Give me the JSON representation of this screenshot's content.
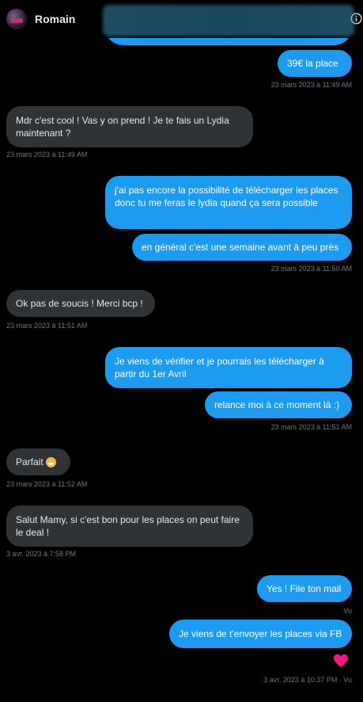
{
  "header": {
    "contact_name": "Romain"
  },
  "messages": [
    {
      "text": "39€ la place",
      "ts": "23 mars 2023 à 11:49 AM"
    },
    {
      "text": "Mdr c'est cool ! Vas y on prend ! Je te fais un Lydia maintenant ?",
      "ts": "23 mars 2023 à 11:49 AM"
    },
    {
      "text": "j'ai pas encore la possibilité de télécharger les places donc tu me feras le lydia quand ça sera possible"
    },
    {
      "text": "en général c'est une semaine avant à peu près",
      "ts": "23 mars 2023 à 11:50 AM"
    },
    {
      "text": "Ok pas de soucis ! Merci bcp !",
      "ts": "23 mars 2023 à 11:51 AM"
    },
    {
      "text": "Je viens de vérifier et je pourrais les télécharger à partir du 1er Avril"
    },
    {
      "text": "relance moi à ce moment là :)",
      "ts": "23 mars 2023 à 11:51 AM"
    },
    {
      "text": "Parfait",
      "ts": "23 mars 2023 à 11:52 AM"
    },
    {
      "text": "Salut Mamy, si c'est bon pour les places on peut faire le deal !",
      "ts": "3 avr. 2023 à 7:58 PM"
    },
    {
      "text": "Yes ! File ton mail",
      "ts": "Vu"
    },
    {
      "text": "Je viens de t'envoyer les places via FB",
      "ts": "3 avr. 2023 à 10:37 PM · Vu"
    }
  ],
  "colors": {
    "sent": "#1d9bf0",
    "received": "#2f3336",
    "timestamp": "#71767b",
    "reaction": "#f91880"
  },
  "icons": {
    "info": "info-icon",
    "reaction": "heart-icon",
    "emoji": "grinning-face-emoji"
  }
}
